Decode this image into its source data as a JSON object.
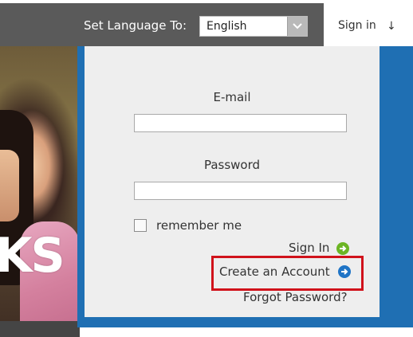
{
  "header": {
    "language_label": "Set Language To:",
    "language_selected": "English",
    "signin_link": "Sign in",
    "signin_arrow": "↓"
  },
  "hero": {
    "big_text": "KS"
  },
  "login": {
    "email_label": "E-mail",
    "email_value": "",
    "password_label": "Password",
    "password_value": "",
    "remember_label": "remember me",
    "remember_checked": false,
    "signin_button": "Sign In",
    "create_account_link": "Create an Account",
    "forgot_password_link": "Forgot Password?"
  },
  "colors": {
    "topbar": "#5a5a5a",
    "panel": "#eeeeee",
    "accent_blue": "#1f6fb3",
    "signin_green": "#6cb524",
    "create_blue": "#1f74c6",
    "highlight_red": "#d0121b"
  },
  "icons": {
    "dropdown": "chevron-down-icon",
    "signin": "arrow-right-circle-green-icon",
    "create": "arrow-right-circle-blue-icon"
  }
}
